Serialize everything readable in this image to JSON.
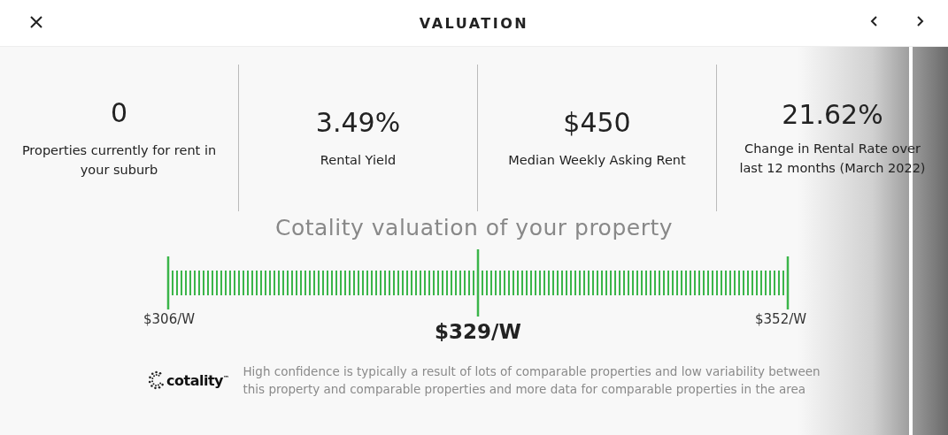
{
  "header": {
    "title": "VALUATION"
  },
  "stats": [
    {
      "value": "0",
      "label": "Properties currently for rent in your suburb"
    },
    {
      "value": "3.49%",
      "label": "Rental Yield"
    },
    {
      "value": "$450",
      "label": "Median Weekly Asking Rent"
    },
    {
      "value": "21.62%",
      "label": "Change in Rental Rate over last 12 months (March 2022)"
    }
  ],
  "valuation": {
    "title": "Cotality valuation of your property",
    "low": "$306/W",
    "estimate": "$329/W",
    "high": "$352/W"
  },
  "footer": {
    "logo_text": "cotality$^{™}$",
    "note": "High confidence is typically a result of lots of comparable properties and low variability between this property and comparable properties and more data for comparable properties in the area"
  }
}
